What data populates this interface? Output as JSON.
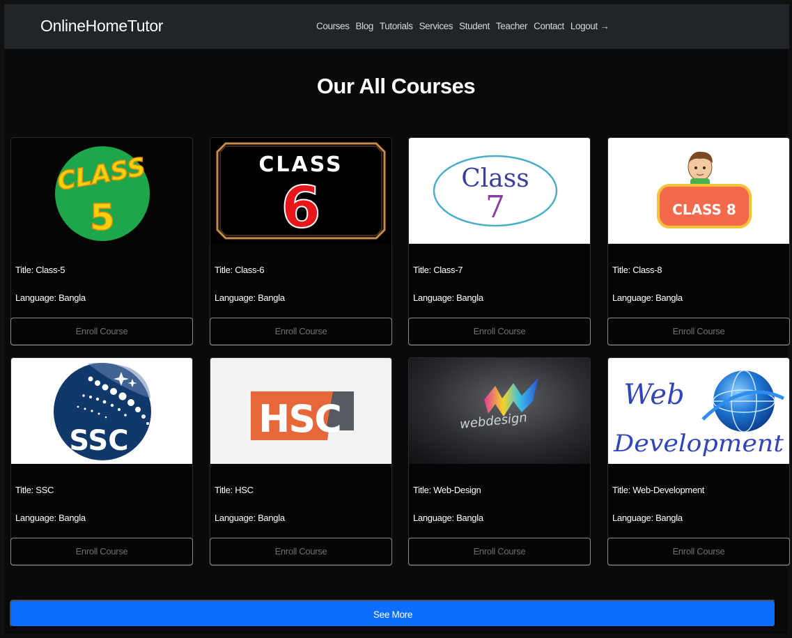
{
  "navbar": {
    "brand": "OnlineHomeTutor",
    "links": [
      "Courses",
      "Blog",
      "Tutorials",
      "Services",
      "Student",
      "Teacher",
      "Contact",
      "Logout →"
    ]
  },
  "page": {
    "title": "Our All Courses",
    "see_more_label": "See More"
  },
  "courses": [
    {
      "title": "Title: Class-5",
      "language": "Language: Bangla",
      "enroll_label": "Enroll Course",
      "image_text": [
        "CLASS",
        "5"
      ]
    },
    {
      "title": "Title: Class-6",
      "language": "Language: Bangla",
      "enroll_label": "Enroll Course",
      "image_text": [
        "CLASS",
        "6"
      ]
    },
    {
      "title": "Title: Class-7",
      "language": "Language: Bangla",
      "enroll_label": "Enroll Course",
      "image_text": [
        "Class",
        "7"
      ]
    },
    {
      "title": "Title: Class-8",
      "language": "Language: Bangla",
      "enroll_label": "Enroll Course",
      "image_text": [
        "CLASS 8"
      ]
    },
    {
      "title": "Title: SSC",
      "language": "Language: Bangla",
      "enroll_label": "Enroll Course",
      "image_text": [
        "SSC"
      ]
    },
    {
      "title": "Title: HSC",
      "language": "Language: Bangla",
      "enroll_label": "Enroll Course",
      "image_text": [
        "HSC"
      ]
    },
    {
      "title": "Title: Web-Design",
      "language": "Language: Bangla",
      "enroll_label": "Enroll Course",
      "image_text": [
        "webdesign"
      ]
    },
    {
      "title": "Title: Web-Development",
      "language": "Language: Bangla",
      "enroll_label": "Enroll Course",
      "image_text": [
        "Web",
        "Development"
      ]
    }
  ],
  "colors": {
    "navbar_bg": "#212529",
    "page_bg": "#0a0a0a",
    "primary_button": "#0d6efd",
    "enroll_text": "#6f6f6f"
  }
}
